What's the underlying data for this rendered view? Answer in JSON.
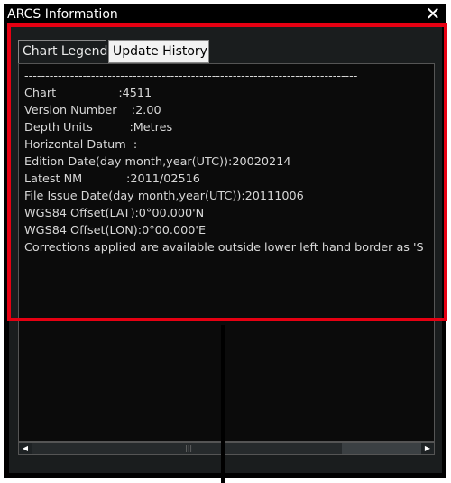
{
  "window": {
    "title": "ARCS Information",
    "close_glyph": "✕"
  },
  "tabs": [
    {
      "label": "Chart Legend",
      "active": true
    },
    {
      "label": "Update History",
      "active": false
    }
  ],
  "legend": {
    "separator": "--------------------------------------------------------------------------------",
    "lines": [
      "Chart                 :4511",
      "Version Number    :2.00",
      "Depth Units          :Metres",
      "Horizontal Datum  :",
      "Edition Date(day month,year(UTC)):20020214",
      "Latest NM            :2011/02516",
      "File Issue Date(day month,year(UTC)):20111006",
      "WGS84 Offset(LAT):0°00.000'N",
      "WGS84 Offset(LON):0°00.000'E",
      "",
      "Corrections applied are available outside lower left hand border as 'S"
    ]
  },
  "scrollbar": {
    "left_arrow": "◀",
    "right_arrow": "▶",
    "grip": "|||"
  },
  "colors": {
    "highlight": "#e60012",
    "background": "#000000",
    "text": "#d8d8d8"
  }
}
